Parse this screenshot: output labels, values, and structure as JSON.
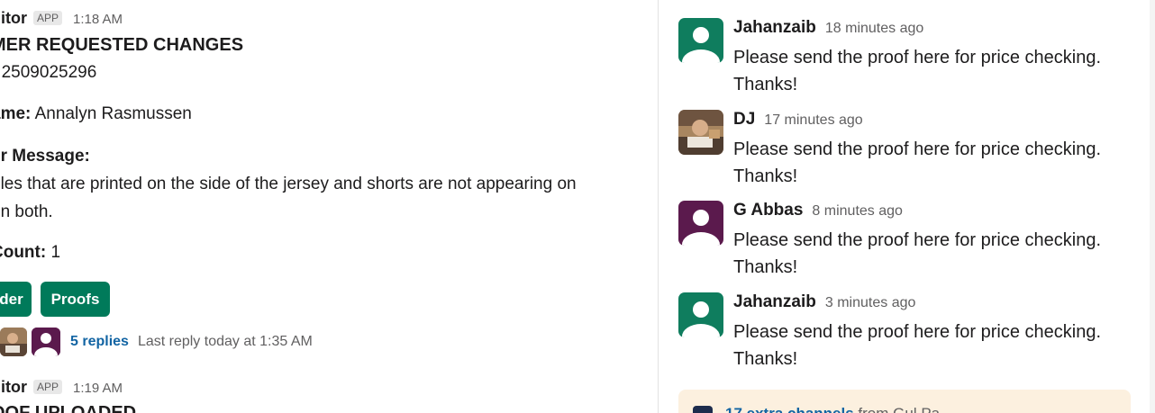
{
  "channel": {
    "msg1": {
      "sender": "nitor",
      "badge": "APP",
      "time": "1:18 AM",
      "title": "MER REQUESTED CHANGES",
      "order_label": ":",
      "order_value": "2509025296",
      "name_label": "ame:",
      "name_value": "Annalyn Rasmussen",
      "message_label": "er Message:",
      "message_line1": "gles that are printed on the side of the jersey and shorts are not appearing on",
      "message_line2": "on both.",
      "count_label": "Count:",
      "count_value": "1",
      "button_order": "der",
      "button_proofs": "Proofs",
      "replies_link": "5 replies",
      "last_reply": "Last reply today at 1:35 AM"
    },
    "msg2": {
      "sender": "nitor",
      "badge": "APP",
      "time": "1:19 AM",
      "title_partial": "OOF UPLOADED"
    }
  },
  "thread": {
    "messages": [
      {
        "name": "Jahanzaib",
        "time": "18 minutes ago",
        "text": "Please send the proof here for price checking. Thanks!",
        "avatar": "default-user-avatar-green"
      },
      {
        "name": "DJ",
        "time": "17 minutes ago",
        "text": "Please send the proof here for price checking. Thanks!",
        "avatar": "photo-avatar"
      },
      {
        "name": "G Abbas",
        "time": "8 minutes ago",
        "text": "Please send the proof here for price checking. Thanks!",
        "avatar": "default-user-avatar-purple"
      },
      {
        "name": "Jahanzaib",
        "time": "3 minutes ago",
        "text": "Please send the proof here for price checking. Thanks!",
        "avatar": "default-user-avatar-green"
      }
    ],
    "banner": {
      "link": "17 extra channels",
      "rest": " from Gul Pa..."
    }
  },
  "colors": {
    "accent_green": "#007a5a",
    "link_blue": "#1264a3",
    "avatar_green": "#0f7d5e",
    "avatar_purple": "#5b1a4d",
    "banner_bg": "#fcf0df"
  }
}
